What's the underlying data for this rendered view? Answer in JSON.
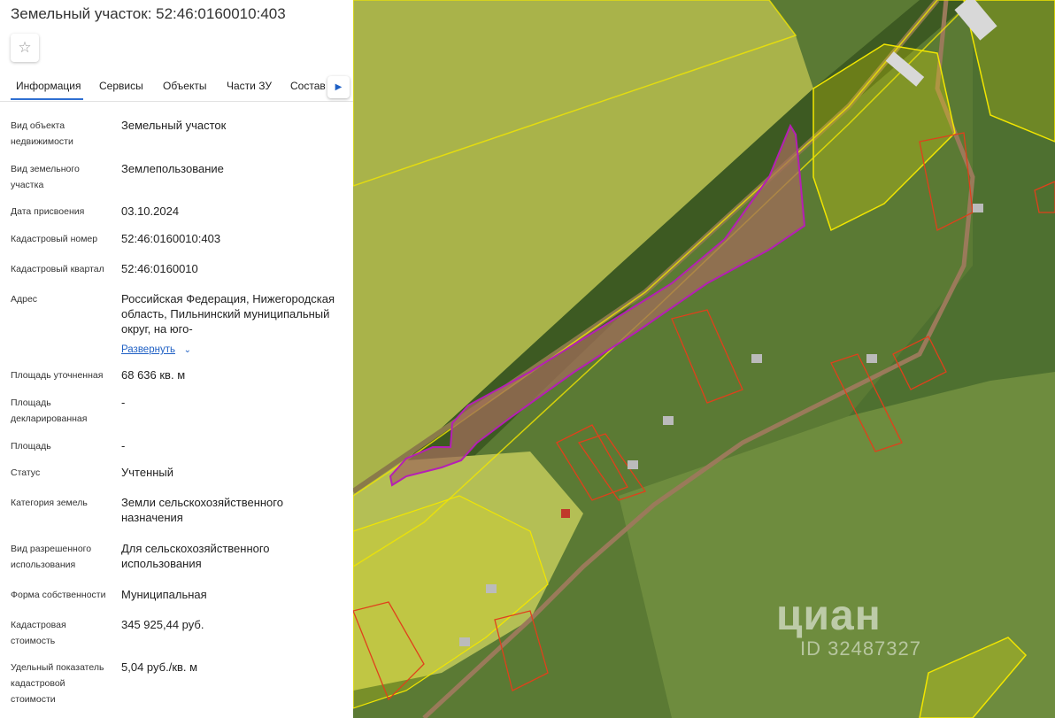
{
  "title": "Земельный участок: 52:46:0160010:403",
  "tabs": [
    "Информация",
    "Сервисы",
    "Объекты",
    "Части ЗУ",
    "Состав"
  ],
  "fields": [
    {
      "label": "Вид объекта недвижимости",
      "value": "Земельный участок"
    },
    {
      "label": "Вид земельного участка",
      "value": "Землепользование"
    },
    {
      "label": "Дата присвоения",
      "value": "03.10.2024"
    },
    {
      "label": "Кадастровый номер",
      "value": "52:46:0160010:403"
    },
    {
      "label": "Кадастровый квартал",
      "value": "52:46:0160010"
    },
    {
      "label": "Адрес",
      "value": "Российская Федерация, Нижегородская область, Пильнинский муниципальный округ, на юго-",
      "link": "Развернуть"
    },
    {
      "label": "Площадь уточненная",
      "value": "68 636 кв. м"
    },
    {
      "label": "Площадь декларированная",
      "value": "-"
    },
    {
      "label": "Площадь",
      "value": "-"
    },
    {
      "label": "Статус",
      "value": "Учтенный"
    },
    {
      "label": "Категория земель",
      "value": "Земли сельскохозяйственного назначения"
    },
    {
      "label": "Вид разрешенного использования",
      "value": "Для сельскохозяйственного использования"
    },
    {
      "label": "Форма собственности",
      "value": "Муниципальная"
    },
    {
      "label": "Кадастровая стоимость",
      "value": "345 925,44 руб."
    },
    {
      "label": "Удельный показатель кадастровой стоимости",
      "value": "5,04 руб./кв. м"
    }
  ],
  "map": {
    "watermark": "циан",
    "watermark_id": "ID 32487327"
  },
  "colors": {
    "accent": "#2f6fd1",
    "parcel_outline": "#b51fb5",
    "cadastral_yellow": "#f2e600",
    "plot_red": "#e0401b"
  }
}
